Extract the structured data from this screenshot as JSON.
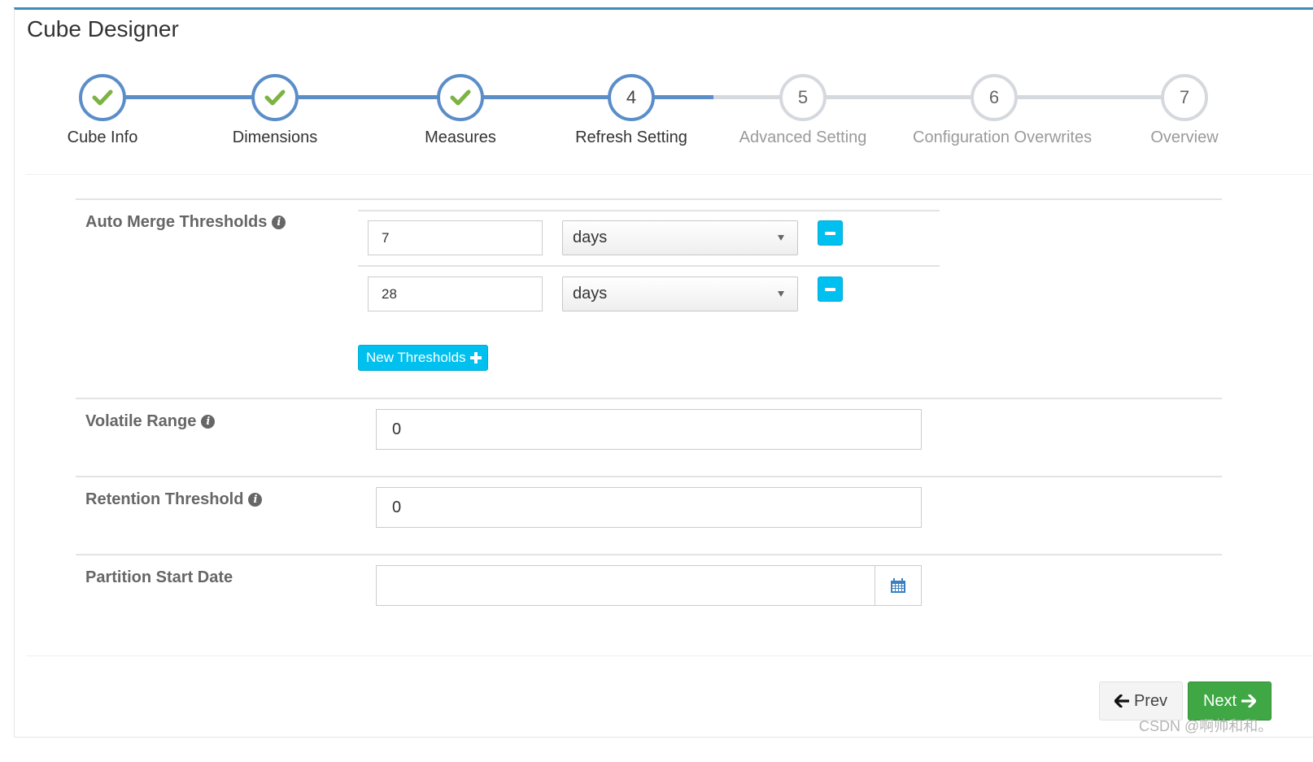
{
  "page": {
    "title": "Cube Designer"
  },
  "wizard": {
    "steps": [
      {
        "label": "Cube Info",
        "number": "1",
        "state": "done"
      },
      {
        "label": "Dimensions",
        "number": "2",
        "state": "done"
      },
      {
        "label": "Measures",
        "number": "3",
        "state": "done"
      },
      {
        "label": "Refresh Setting",
        "number": "4",
        "state": "current"
      },
      {
        "label": "Advanced Setting",
        "number": "5",
        "state": "todo"
      },
      {
        "label": "Configuration Overwrites",
        "number": "6",
        "state": "todo"
      },
      {
        "label": "Overview",
        "number": "7",
        "state": "todo"
      }
    ],
    "check_color": "#7cb342",
    "done_color": "#5b8ec9",
    "todo_color": "#d5d9de"
  },
  "form": {
    "auto_merge": {
      "label": "Auto Merge Thresholds",
      "info_icon": "info-circle-icon",
      "thresholds": [
        {
          "value": "7",
          "unit": "days"
        },
        {
          "value": "28",
          "unit": "days"
        }
      ],
      "new_button_label": "New Thresholds",
      "new_button_icon": "plus-icon"
    },
    "volatile_range": {
      "label": "Volatile Range",
      "value": "0",
      "info_icon": "info-circle-icon"
    },
    "retention_threshold": {
      "label": "Retention Threshold",
      "value": "0",
      "info_icon": "info-circle-icon"
    },
    "partition_start_date": {
      "label": "Partition Start Date",
      "value": "",
      "icon": "calendar-icon"
    }
  },
  "footer": {
    "prev_label": "Prev",
    "prev_icon": "arrow-left-icon",
    "next_label": "Next",
    "next_icon": "arrow-right-icon",
    "next_color": "#3fa743",
    "accent_color": "#00c0ef"
  },
  "watermark": "CSDN @啊帅和和。"
}
